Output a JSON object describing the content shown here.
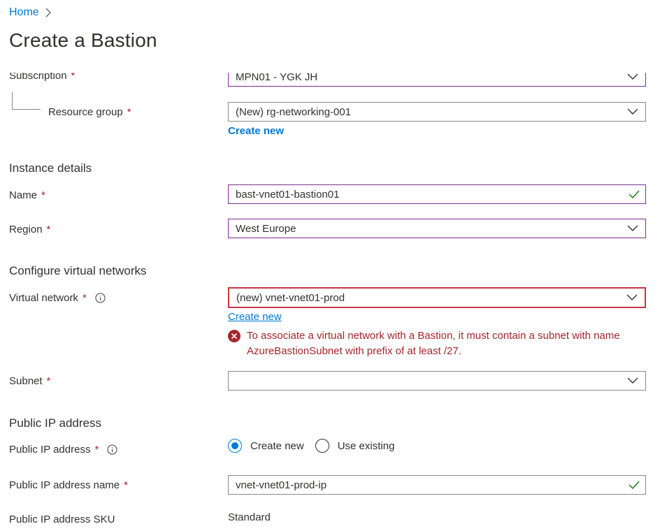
{
  "breadcrumb": {
    "home": "Home"
  },
  "page": {
    "title": "Create a Bastion"
  },
  "form": {
    "subscription": {
      "label": "Subscription",
      "value": "MPN01 - YGK JH"
    },
    "resource_group": {
      "label": "Resource group",
      "value": "(New) rg-networking-001",
      "create_new": "Create new"
    },
    "instance_details": "Instance details",
    "name": {
      "label": "Name",
      "value": "bast-vnet01-bastion01"
    },
    "region": {
      "label": "Region",
      "value": "West Europe"
    },
    "configure_vnets": "Configure virtual networks",
    "virtual_network": {
      "label": "Virtual network",
      "value": "(new) vnet-vnet01-prod",
      "create_new": "Create new",
      "error": "To associate a virtual network with a Bastion, it must contain a subnet with name AzureBastionSubnet with prefix of at least /27."
    },
    "subnet": {
      "label": "Subnet",
      "value": ""
    },
    "public_ip_section": "Public IP address",
    "public_ip": {
      "label": "Public IP address",
      "option_create": "Create new",
      "option_existing": "Use existing",
      "selected": "Create new"
    },
    "public_ip_name": {
      "label": "Public IP address name",
      "value": "vnet-vnet01-prod-ip"
    },
    "public_ip_sku": {
      "label": "Public IP address SKU",
      "value": "Standard"
    },
    "required_marker": "*"
  },
  "colors": {
    "accent": "#0078d4",
    "error": "#a4262c",
    "valid": "#107c10",
    "focus_border": "#7a2e8e"
  }
}
